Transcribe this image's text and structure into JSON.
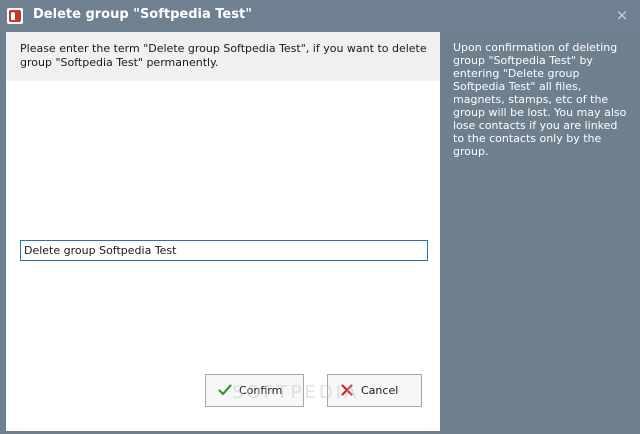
{
  "window": {
    "title": "Delete group \"Softpedia Test\"",
    "close_glyph": "×"
  },
  "instruction": {
    "text": "Please enter the term \"Delete group Softpedia Test\", if you want to delete group \"Softpedia Test\" permanently."
  },
  "input": {
    "value": "Delete group Softpedia Test"
  },
  "buttons": {
    "confirm_label": "Confirm",
    "cancel_label": "Cancel"
  },
  "side_panel": {
    "text": "Upon confirmation of deleting group \"Softpedia Test\" by entering \"Delete group Softpedia Test\" all files, magnets, stamps, etc of the group will be lost. You may also lose contacts if you are linked to the contacts only by the group."
  },
  "watermark": "SOFTPEDIA",
  "colors": {
    "titlebar": "#6f8090",
    "side_panel": "#6e7f8e",
    "input_border": "#2b6fb6",
    "confirm_icon": "#3a9a2f",
    "cancel_icon": "#d32424"
  },
  "icons": {
    "app": "magnet-icon",
    "close": "close-icon",
    "confirm": "checkmark-icon",
    "cancel": "x-icon"
  }
}
